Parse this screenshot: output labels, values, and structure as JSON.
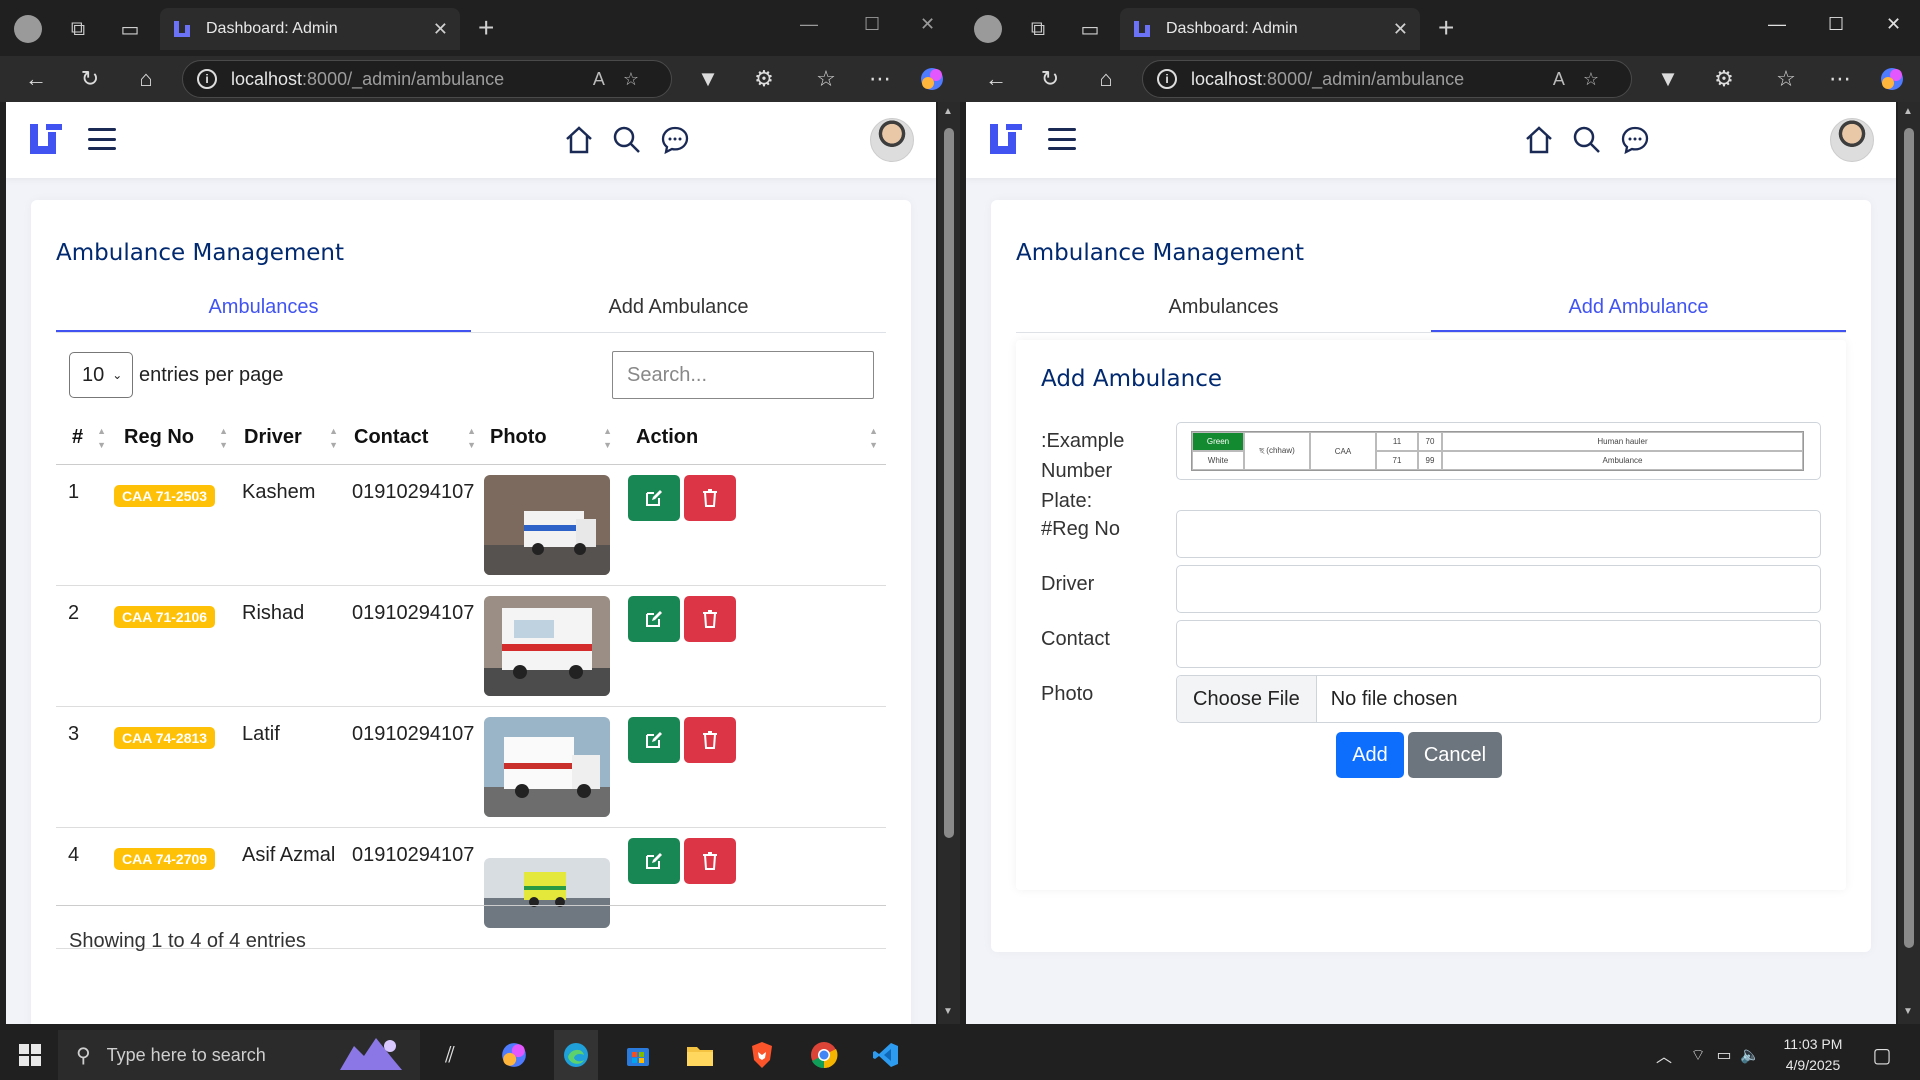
{
  "browser": {
    "tab_title": "Dashboard: Admin",
    "url_host": "localhost",
    "url_rest": ":8000/_admin/ambulance"
  },
  "left": {
    "card_title": "Ambulance Management",
    "tabs": [
      "Ambulances",
      "Add Ambulance"
    ],
    "entries_value": "10",
    "entries_label": "entries per page",
    "search_placeholder": "Search...",
    "columns": [
      "#",
      "Reg No",
      "Driver",
      "Contact",
      "Photo",
      "Action"
    ],
    "rows": [
      {
        "num": "1",
        "reg": "CAA 71-2503",
        "driver": "Kashem",
        "contact": "01910294107"
      },
      {
        "num": "2",
        "reg": "CAA 71-2106",
        "driver": "Rishad",
        "contact": "01910294107"
      },
      {
        "num": "3",
        "reg": "CAA 74-2813",
        "driver": "Latif",
        "contact": "01910294107"
      },
      {
        "num": "4",
        "reg": "CAA 74-2709",
        "driver": "Asif Azmal",
        "contact": "01910294107"
      }
    ],
    "showing": "Showing 1 to 4 of 4 entries"
  },
  "right": {
    "card_title": "Ambulance Management",
    "tabs": [
      "Ambulances",
      "Add Ambulance"
    ],
    "form_title": "Add Ambulance",
    "example_label_1": ":Example",
    "example_label_2": "Number",
    "example_label_3": "Plate:",
    "plate": {
      "green": "Green",
      "white": "White",
      "chhaw": "ছ (chhaw)",
      "caa": "CAA",
      "n11": "11",
      "n70": "70",
      "n71": "71",
      "n99": "99",
      "human": "Human hauler",
      "ambulance": "Ambulance"
    },
    "reg_label": "#Reg No",
    "driver_label": "Driver",
    "contact_label": "Contact",
    "photo_label": "Photo",
    "choose_file": "Choose File",
    "no_file": "No file chosen",
    "add_button": "Add",
    "cancel_button": "Cancel"
  },
  "taskbar": {
    "search_placeholder": "Type here to search",
    "time": "11:03 PM",
    "date": "4/9/2025"
  },
  "colors": {
    "accent": "#4154f1",
    "title": "#012970",
    "badge": "#ffc107",
    "edit": "#198754",
    "delete": "#dc3545",
    "primary": "#0d6efd",
    "secondary": "#6c757d"
  }
}
